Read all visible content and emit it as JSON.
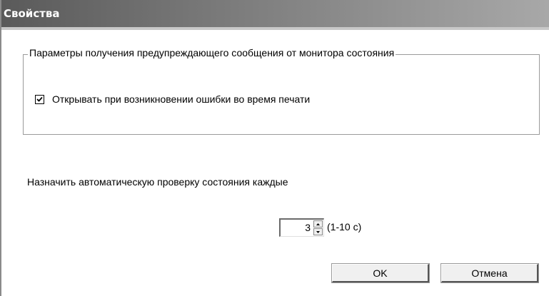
{
  "window": {
    "title": "Свойства"
  },
  "group": {
    "legend": "Параметры получения предупреждающего сообщения от монитора состояния",
    "checkbox_label": "Открывать при возникновении ошибки во время печати",
    "checkbox_checked": true
  },
  "auto_check": {
    "label": "Назначить автоматическую проверку состояния каждые",
    "spinner_value": "3",
    "range": "(1-10 с)"
  },
  "buttons": {
    "ok": "OK",
    "cancel": "Отмена"
  },
  "colors": {
    "titlebar_dark": "#5a5a5a",
    "titlebar_light": "#a8a8a8",
    "background": "#ffffff"
  },
  "icons": [
    "checkmark-icon",
    "spin-up-arrow-icon",
    "spin-down-arrow-icon"
  ]
}
